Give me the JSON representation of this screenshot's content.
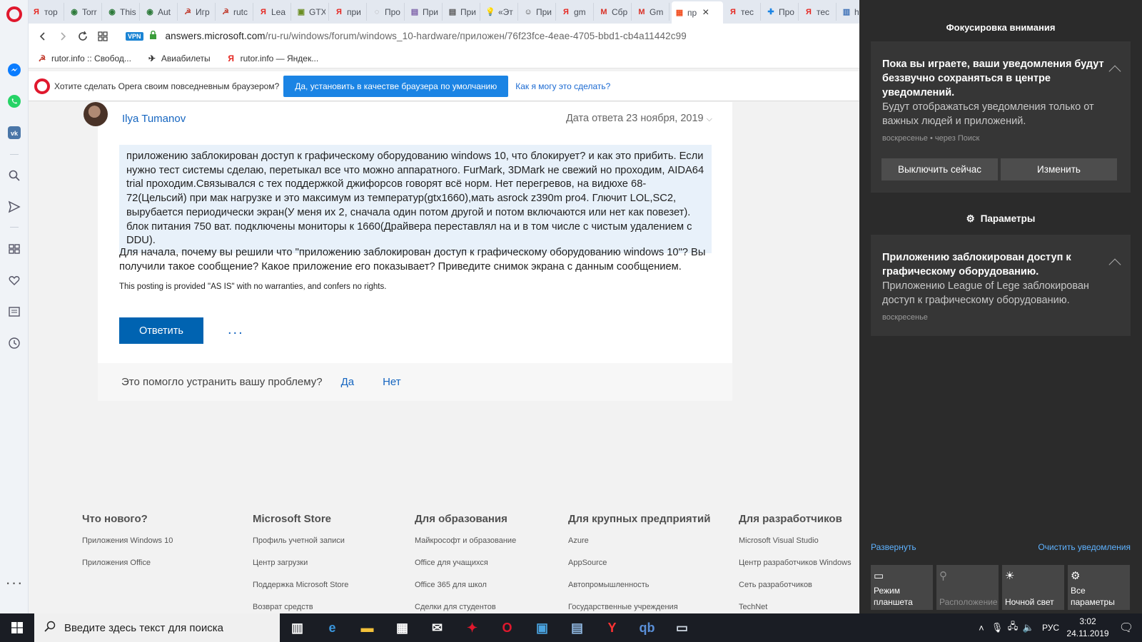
{
  "browser": {
    "tabs": [
      {
        "label": "тор",
        "icon": "yandex-icon",
        "color": "#e52620"
      },
      {
        "label": "Torr",
        "icon": "globe-icon",
        "color": "#2d7a3a"
      },
      {
        "label": "This",
        "icon": "globe-icon",
        "color": "#2d7a3a"
      },
      {
        "label": "Aut",
        "icon": "globe-icon",
        "color": "#2d7a3a"
      },
      {
        "label": "Игр",
        "icon": "rutor-icon",
        "color": "#c0392b"
      },
      {
        "label": "rutc",
        "icon": "rutor-icon",
        "color": "#c0392b"
      },
      {
        "label": "Lea",
        "icon": "yandex-icon",
        "color": "#e52620"
      },
      {
        "label": "GTX",
        "icon": "nvidia-icon",
        "color": "#6b8e23"
      },
      {
        "label": "при",
        "icon": "yandex-icon",
        "color": "#e52620"
      },
      {
        "label": "Про",
        "icon": "loading-icon",
        "color": "#999999"
      },
      {
        "label": "При",
        "icon": "document-icon",
        "color": "#7b5ea7"
      },
      {
        "label": "При",
        "icon": "document-icon",
        "color": "#555555"
      },
      {
        "label": "«Эт",
        "icon": "bulb-icon",
        "color": "#f0b400"
      },
      {
        "label": "При",
        "icon": "smiley-icon",
        "color": "#444444"
      },
      {
        "label": "gm",
        "icon": "yandex-icon",
        "color": "#e52620"
      },
      {
        "label": "Сбр",
        "icon": "gmail-icon",
        "color": "#d93025"
      },
      {
        "label": "Gm",
        "icon": "gmail-icon",
        "color": "#d93025"
      },
      {
        "label": "пр",
        "icon": "microsoft-icon",
        "color": "#f25022",
        "active": true
      },
      {
        "label": "тес",
        "icon": "yandex-icon",
        "color": "#e52620"
      },
      {
        "label": "Про",
        "icon": "puzzle-icon",
        "color": "#1b84e4"
      },
      {
        "label": "тес",
        "icon": "yandex-icon",
        "color": "#e52620"
      },
      {
        "label": "htt",
        "icon": "save-icon",
        "color": "#3b6fb6"
      }
    ],
    "vpn_label": "VPN",
    "url_host": "answers.microsoft.com",
    "url_path": "/ru-ru/windows/forum/windows_10-hardware/приложен/76f23fce-4eae-4705-bbd1-cb4a11442c99",
    "bookmarks": [
      {
        "label": "rutor.info :: Свобод...",
        "icon": "rutor-icon"
      },
      {
        "label": "Авиабилеты",
        "icon": "plane-icon"
      },
      {
        "label": "rutor.info — Яндек...",
        "icon": "yandex-icon"
      }
    ],
    "default_prompt": {
      "question": "Хотите сделать Opera своим повседневным браузером?",
      "button": "Да, установить в качестве браузера по умолчанию",
      "link": "Как я могу это сделать?"
    }
  },
  "answer": {
    "author": "Ilya Tumanov",
    "date": "Дата ответа 23 ноября, 2019",
    "quote": "приложению заблокирован доступ к графическому оборудованию windows 10, что блокирует? и как это прибить. Если нужно тест системы сделаю, перетыкал все что можно аппаратного. FurMark, 3DMark не свежий но проходим, AIDA64 trial проходим.Связывался с тех поддержкой джифорсов говорят всё норм. Нет перегревов, на видюхе 68-72(Цельсий) при мак нагрузке и это максимум из температур(gtx1660),мать asrock z390m pro4. Глючит LOL,SC2, вырубается периодически экран(У меня их 2, сначала один потом другой и потом включаются или нет как повезет). блок питания 750 ват. подключены мониторы к 1660(Драйвера переставлял на и в том числе с чистым удалением с DDU).",
    "text": "Для начала, почему вы решили что \"приложению заблокирован доступ к графическому оборудованию windows 10\"? Вы получили такое сообщение? Какое приложение его показывает? Приведите снимок экрана с данным сообщением.",
    "disclaimer": "This posting is provided \"AS IS\" with no warranties, and confers no rights.",
    "reply_button": "Ответить",
    "more": "...",
    "helpful_question": "Это помогло устранить вашу проблему?",
    "helpful_yes": "Да",
    "helpful_no": "Нет"
  },
  "footer": {
    "columns": [
      {
        "title": "Что нового?",
        "links": [
          "Приложения Windows 10",
          "Приложения Office"
        ]
      },
      {
        "title": "Microsoft Store",
        "links": [
          "Профиль учетной записи",
          "Центр загрузки",
          "Поддержка Microsoft Store",
          "Возврат средств"
        ]
      },
      {
        "title": "Для образования",
        "links": [
          "Майкрософт и образование",
          "Office для учащихся",
          "Office 365 для школ",
          "Сделки для студентов"
        ]
      },
      {
        "title": "Для крупных предприятий",
        "links": [
          "Azure",
          "AppSource",
          "Автопромышленность",
          "Государственные учреждения"
        ]
      },
      {
        "title": "Для разработчиков",
        "links": [
          "Microsoft Visual Studio",
          "Центр разработчиков Windows",
          "Сеть разработчиков",
          "TechNet"
        ]
      }
    ]
  },
  "action_center": {
    "focus_title": "Фокусировка внимания",
    "focus_card": {
      "title": "Пока вы играете, ваши уведомления будут беззвучно сохраняться в центре уведомлений.",
      "body": "Будут отображаться уведомления только от важных людей и приложений.",
      "meta": "воскресенье • через Поиск",
      "btn_off": "Выключить сейчас",
      "btn_change": "Изменить"
    },
    "settings_header": "Параметры",
    "notif_card": {
      "title": "Приложению заблокирован доступ к графическому оборудованию.",
      "body": "Приложению League of Lege заблокирован доступ к графическому оборудованию.",
      "meta": "воскресенье"
    },
    "expand": "Развернуть",
    "clear": "Очистить уведомления",
    "quick_actions": [
      {
        "label": "Режим планшета",
        "icon": "tablet-mode-icon",
        "enabled": true
      },
      {
        "label": "Расположение",
        "icon": "location-icon",
        "enabled": false
      },
      {
        "label": "Ночной свет",
        "icon": "brightness-icon",
        "enabled": true
      },
      {
        "label": "Все параметры",
        "icon": "gear-icon",
        "enabled": true
      }
    ]
  },
  "taskbar": {
    "search_placeholder": "Введите здесь текст для поиска",
    "apps": [
      "task-view-icon",
      "edge-icon",
      "file-explorer-icon",
      "store-icon",
      "mail-icon",
      "game-app-icon",
      "opera-icon",
      "control-panel-icon",
      "network-app-icon",
      "yandex-browser-icon",
      "qbittorrent-icon",
      "display-app-icon"
    ],
    "language": "РУС",
    "time": "3:02",
    "date": "24.11.2019"
  },
  "colors": {
    "accent_blue": "#0063b1",
    "opera_red": "#e0182d",
    "action_center_bg": "#2b2b2b"
  }
}
